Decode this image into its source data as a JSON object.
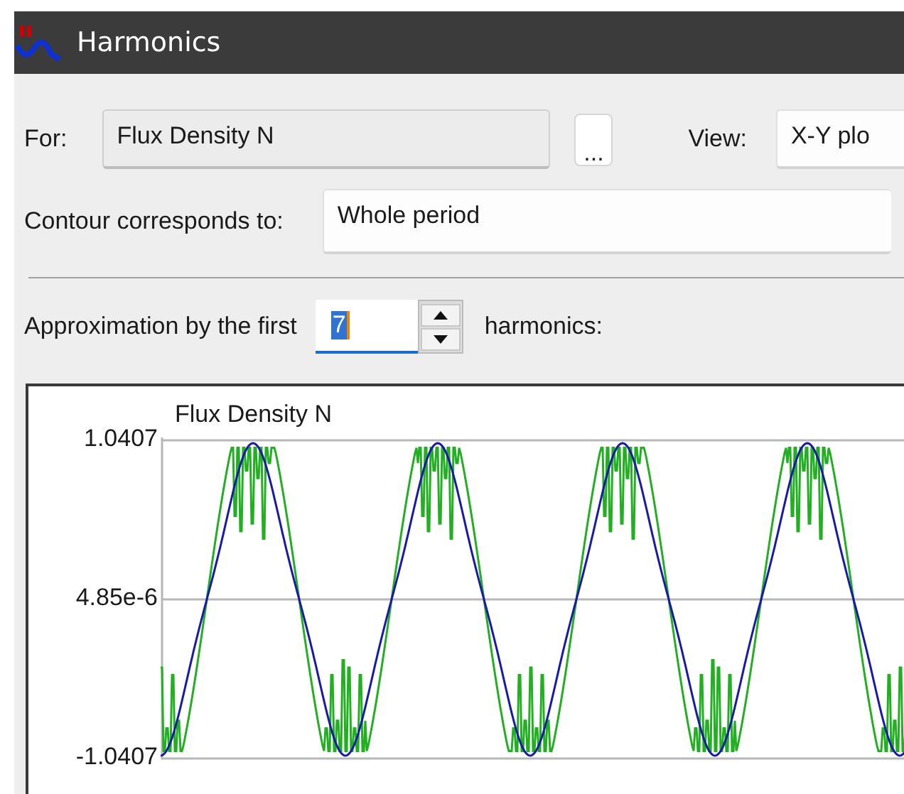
{
  "window": {
    "title": "Harmonics"
  },
  "for_field": {
    "label": "For:",
    "value": "Flux Density N"
  },
  "browse_button": {
    "label": "..."
  },
  "view": {
    "label": "View:",
    "value": "X-Y plo"
  },
  "contour": {
    "label": "Contour corresponds to:",
    "value": "Whole period"
  },
  "approximation": {
    "label": "Approximation by the first",
    "value": "7",
    "value_selected": true,
    "suffix": "harmonics:"
  },
  "chart": {
    "title": "Flux Density N",
    "y_labels": [
      "1.0407",
      "4.85e-6",
      "-1.0407"
    ]
  }
}
